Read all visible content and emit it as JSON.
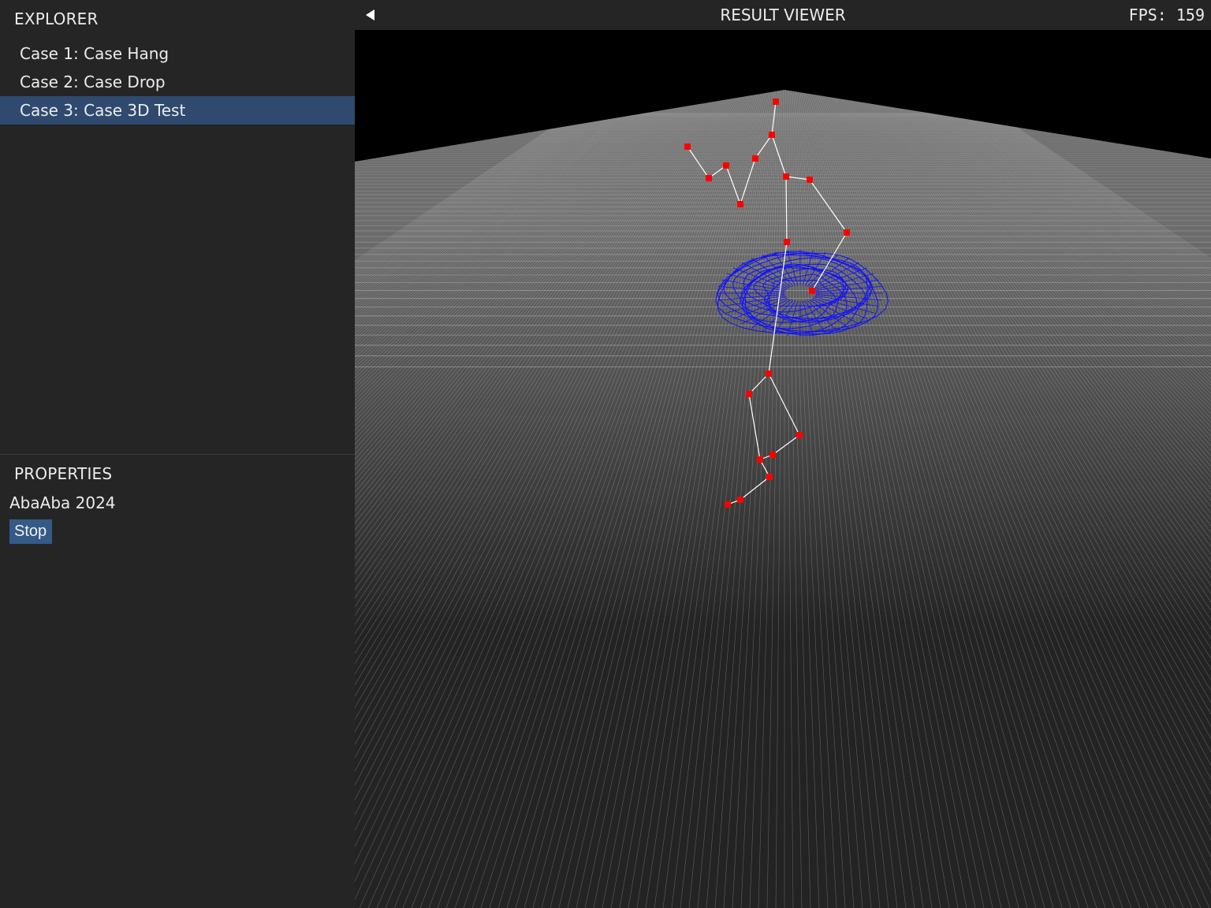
{
  "explorer": {
    "title": "EXPLORER",
    "items": [
      {
        "label": "Case 1: Case Hang",
        "selected": false
      },
      {
        "label": "Case 2: Case Drop",
        "selected": false
      },
      {
        "label": "Case 3: Case 3D Test",
        "selected": true
      }
    ]
  },
  "properties": {
    "title": "PROPERTIES",
    "text": "AbaAba 2024",
    "stop_label": "Stop"
  },
  "viewer": {
    "title": "RESULT VIEWER",
    "fps": "FPS:  159",
    "back_icon": "back-arrow-icon"
  },
  "colors": {
    "sidebar_bg": "#252525",
    "selection": "#2f4a6e",
    "button": "#345a88",
    "floor": "#6e6e6e",
    "grid": "#cfcfcf",
    "joint": "#ff0000",
    "bone": "#ffffff",
    "mesh": "#1010ff"
  }
}
